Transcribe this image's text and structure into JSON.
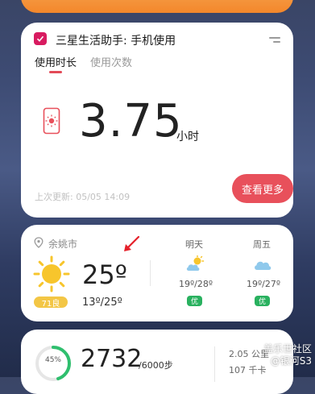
{
  "usage_card": {
    "title": "三星生活助手: 手机使用",
    "tabs": [
      {
        "label": "使用时长",
        "active": true
      },
      {
        "label": "使用次数",
        "active": false
      }
    ],
    "value": "3.75",
    "unit": "小时",
    "last_update": "上次更新:   05/05 14:09",
    "more_button": "查看更多",
    "accent_color": "#e8505b"
  },
  "weather_card": {
    "location": "余姚市",
    "current_temp": "25º",
    "temp_range": "13º/25º",
    "aqi": "71良",
    "forecast": [
      {
        "day": "明天",
        "range": "19º/28º",
        "quality": "优",
        "icon": "partly-cloudy-icon"
      },
      {
        "day": "周五",
        "range": "19º/27º",
        "quality": "优",
        "icon": "cloud-icon"
      }
    ]
  },
  "steps_card": {
    "progress_label": "45%",
    "progress": 0.45,
    "steps": "2732",
    "goal": "/6000步",
    "distance": "2.05 公里",
    "calories": "107 千卡"
  },
  "watermark": {
    "line1": "盖乐世社区",
    "line2": "@银河S3"
  }
}
